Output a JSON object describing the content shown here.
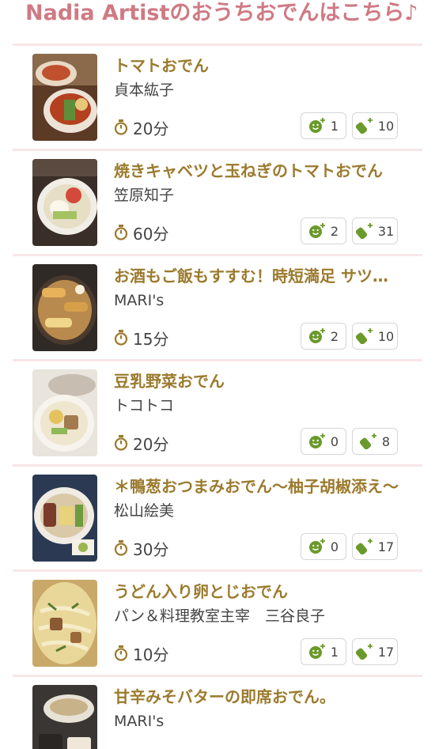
{
  "header": {
    "title": "Nadia Artistのおうちおでんはこちら♪"
  },
  "colors": {
    "accent": "#cf7a84",
    "title": "#9b7a2d",
    "icon_green": "#6a9a2b",
    "divider": "#f8e6e8"
  },
  "icons": {
    "time": "timer-icon",
    "like": "smile-plus-icon",
    "clip": "clip-plus-icon"
  },
  "recipes": [
    {
      "title": "トマトおでん",
      "author": "貞本紘子",
      "time": "20分",
      "likes": "1",
      "clips": "10"
    },
    {
      "title": "焼きキャベツと玉ねぎのトマトおでん",
      "author": "笠原知子",
      "time": "60分",
      "likes": "2",
      "clips": "31"
    },
    {
      "title": "お酒もご飯もすすむ！時短満足 サツマイモおでん",
      "author": "MARI's",
      "time": "15分",
      "likes": "2",
      "clips": "10"
    },
    {
      "title": "豆乳野菜おでん",
      "author": "トコトコ",
      "time": "20分",
      "likes": "0",
      "clips": "8"
    },
    {
      "title": "＊鴨葱おつまみおでん〜柚子胡椒添え〜",
      "author": "松山絵美",
      "time": "30分",
      "likes": "0",
      "clips": "17"
    },
    {
      "title": "うどん入り卵とじおでん",
      "author": "パン＆料理教室主宰　三谷良子",
      "time": "10分",
      "likes": "1",
      "clips": "17"
    },
    {
      "title": "甘辛みそバターの即席おでん。",
      "author": "MARI's",
      "time": "",
      "likes": "",
      "clips": ""
    }
  ]
}
